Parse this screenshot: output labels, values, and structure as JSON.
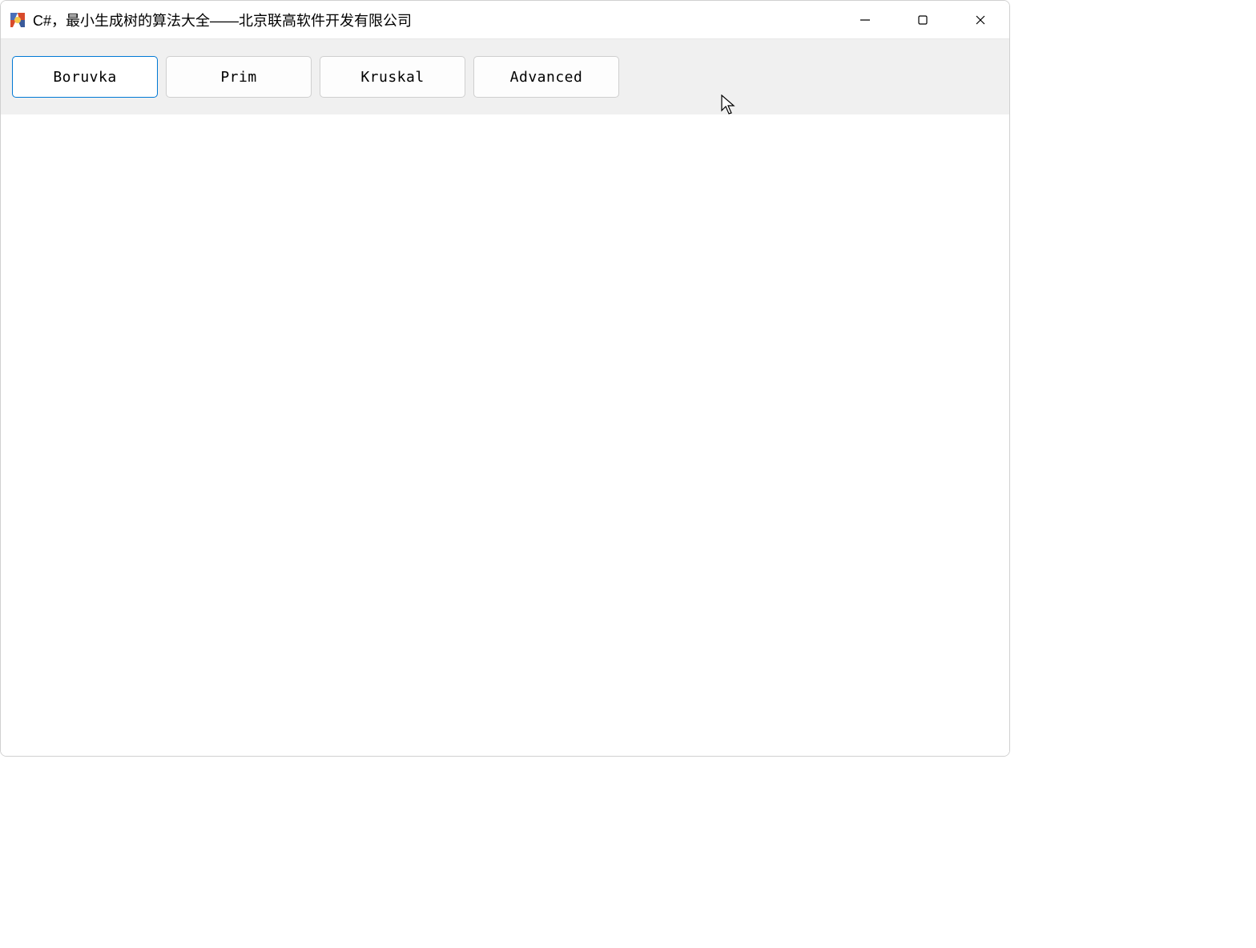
{
  "window": {
    "title": "C#，最小生成树的算法大全——北京联高软件开发有限公司"
  },
  "toolbar": {
    "buttons": [
      {
        "label": "Boruvka",
        "selected": true
      },
      {
        "label": "Prim",
        "selected": false
      },
      {
        "label": "Kruskal",
        "selected": false
      },
      {
        "label": "Advanced",
        "selected": false
      }
    ]
  }
}
